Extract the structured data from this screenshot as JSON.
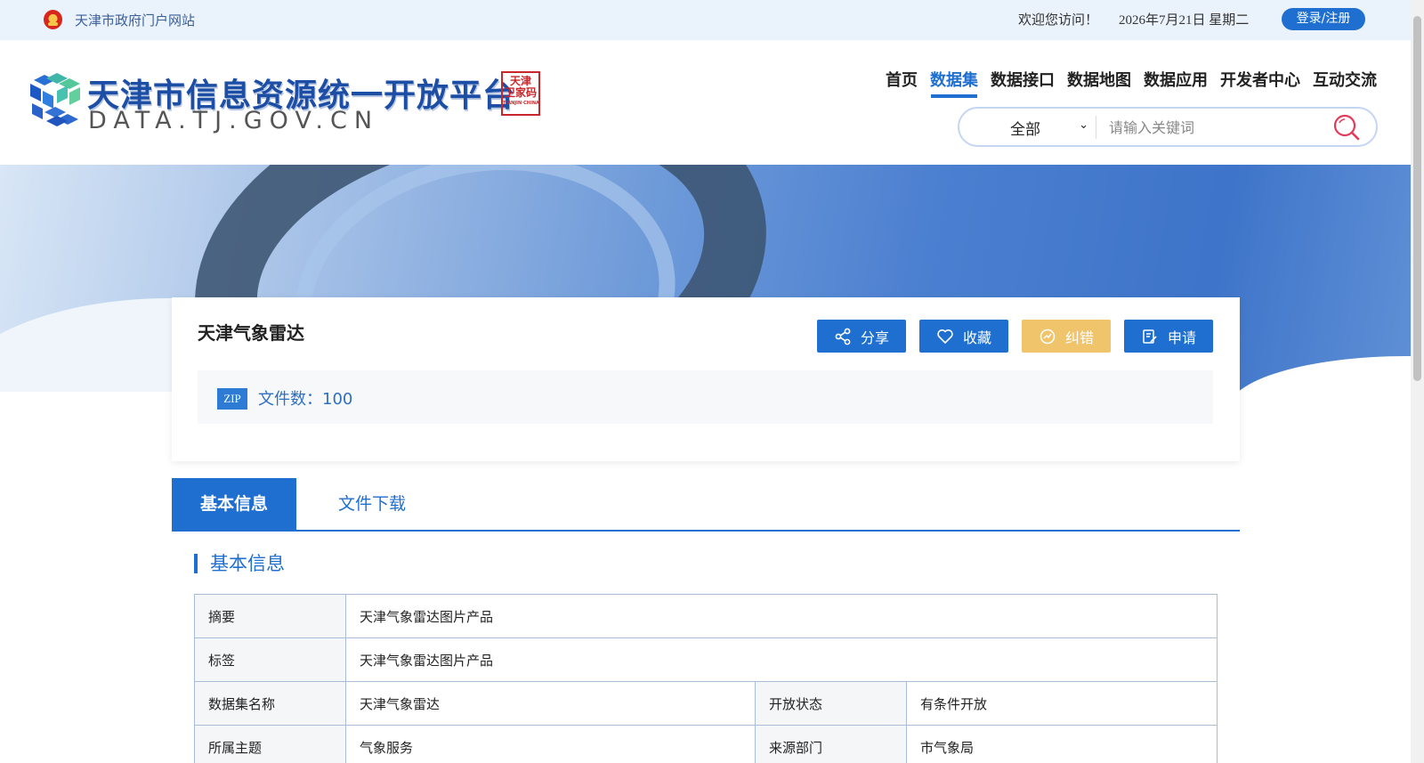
{
  "topbar": {
    "gov_portal": "天津市政府门户网站",
    "welcome": "欢迎您访问！",
    "date": "2026年7月21日  星期二",
    "login": "登录/注册"
  },
  "header": {
    "logo_title": "天津市信息资源统一开放平台",
    "logo_sub": "DATA.TJ.GOV.CN",
    "seal_text": "天津",
    "seal_text2": "卫家码",
    "seal_caption": "TIANJIN·CHINA",
    "nav": [
      {
        "label": "首页"
      },
      {
        "label": "数据集"
      },
      {
        "label": "数据接口"
      },
      {
        "label": "数据地图"
      },
      {
        "label": "数据应用"
      },
      {
        "label": "开发者中心"
      },
      {
        "label": "互动交流"
      }
    ],
    "active_nav": "数据集",
    "search": {
      "scope": "全部",
      "placeholder": "请输入关键词"
    }
  },
  "dataset": {
    "title": "天津气象雷达",
    "actions": {
      "share": "分享",
      "favorite": "收藏",
      "report": "纠错",
      "apply": "申请"
    },
    "file_type": "ZIP",
    "file_count": "文件数：100"
  },
  "tabs": {
    "basic": "基本信息",
    "download": "文件下载"
  },
  "info": {
    "section_title": "基本信息",
    "rows": {
      "summary_label": "摘要",
      "summary_value": "天津气象雷达图片产品",
      "tags_label": "标签",
      "tags_value": "天津气象雷达图片产品",
      "name_label": "数据集名称",
      "name_value": "天津气象雷达",
      "status_label": "开放状态",
      "status_value": "有条件开放",
      "topic_label": "所属主题",
      "topic_value": "气象服务",
      "source_label": "来源部门",
      "source_value": "市气象局"
    }
  },
  "colors": {
    "primary": "#1f6fd0",
    "warn": "#efc46b",
    "topbar_bg": "#eaf2fb"
  }
}
